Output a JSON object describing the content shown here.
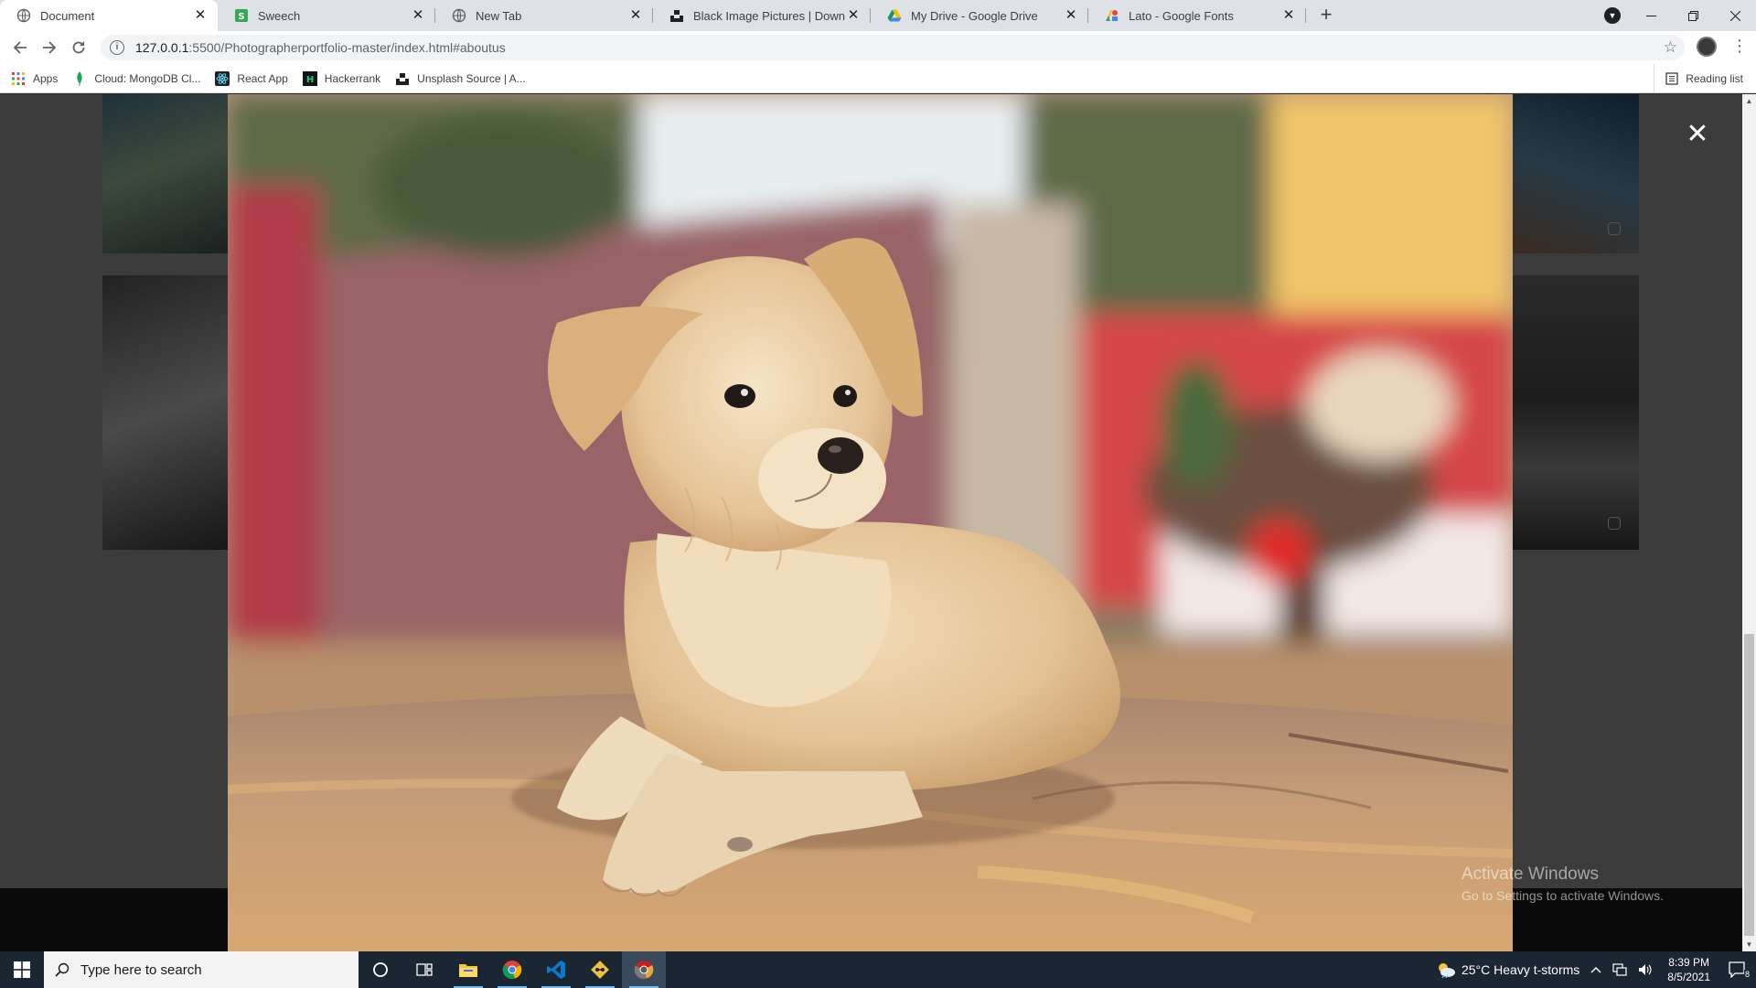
{
  "browser": {
    "tabs": [
      {
        "title": "Document",
        "icon": "globe-icon",
        "active": true
      },
      {
        "title": "Sweech",
        "icon": "sweech-icon",
        "active": false
      },
      {
        "title": "New Tab",
        "icon": "globe-icon",
        "active": false
      },
      {
        "title": "Black Image Pictures | Download",
        "icon": "unsplash-icon",
        "active": false
      },
      {
        "title": "My Drive - Google Drive",
        "icon": "google-drive-icon",
        "active": false
      },
      {
        "title": "Lato - Google Fonts",
        "icon": "google-fonts-icon",
        "active": false
      }
    ],
    "new_tab_label": "+",
    "url_host": "127.0.0.1",
    "url_path": ":5500/Photographerportfolio-master/index.html#aboutus",
    "bookmarks": [
      {
        "label": "Apps",
        "icon": "apps-grid-icon"
      },
      {
        "label": "Cloud: MongoDB Cl...",
        "icon": "mongodb-leaf-icon"
      },
      {
        "label": "React App",
        "icon": "react-icon"
      },
      {
        "label": "Hackerrank",
        "icon": "hackerrank-icon"
      },
      {
        "label": "Unsplash Source | A...",
        "icon": "unsplash-icon"
      }
    ],
    "reading_list_label": "Reading list"
  },
  "page": {
    "lightbox_close_label": "✕",
    "lightbox_image": "puppy-photo"
  },
  "watermark": {
    "title": "Activate Windows",
    "subtitle": "Go to Settings to activate Windows."
  },
  "taskbar": {
    "search_placeholder": "Type here to search",
    "pinned_apps": [
      "cortana-icon",
      "task-view-icon",
      "file-explorer-icon",
      "chrome-icon",
      "vscode-icon",
      "git-icon",
      "chrome-canary-icon"
    ],
    "weather": "25°C  Heavy t-storms",
    "time": "8:39 PM",
    "date": "8/5/2021",
    "notification_count": "8"
  },
  "colors": {
    "tabstrip": "#dee1e6",
    "taskbar": "#1b2633",
    "page_bg": "#3b3b3b"
  }
}
